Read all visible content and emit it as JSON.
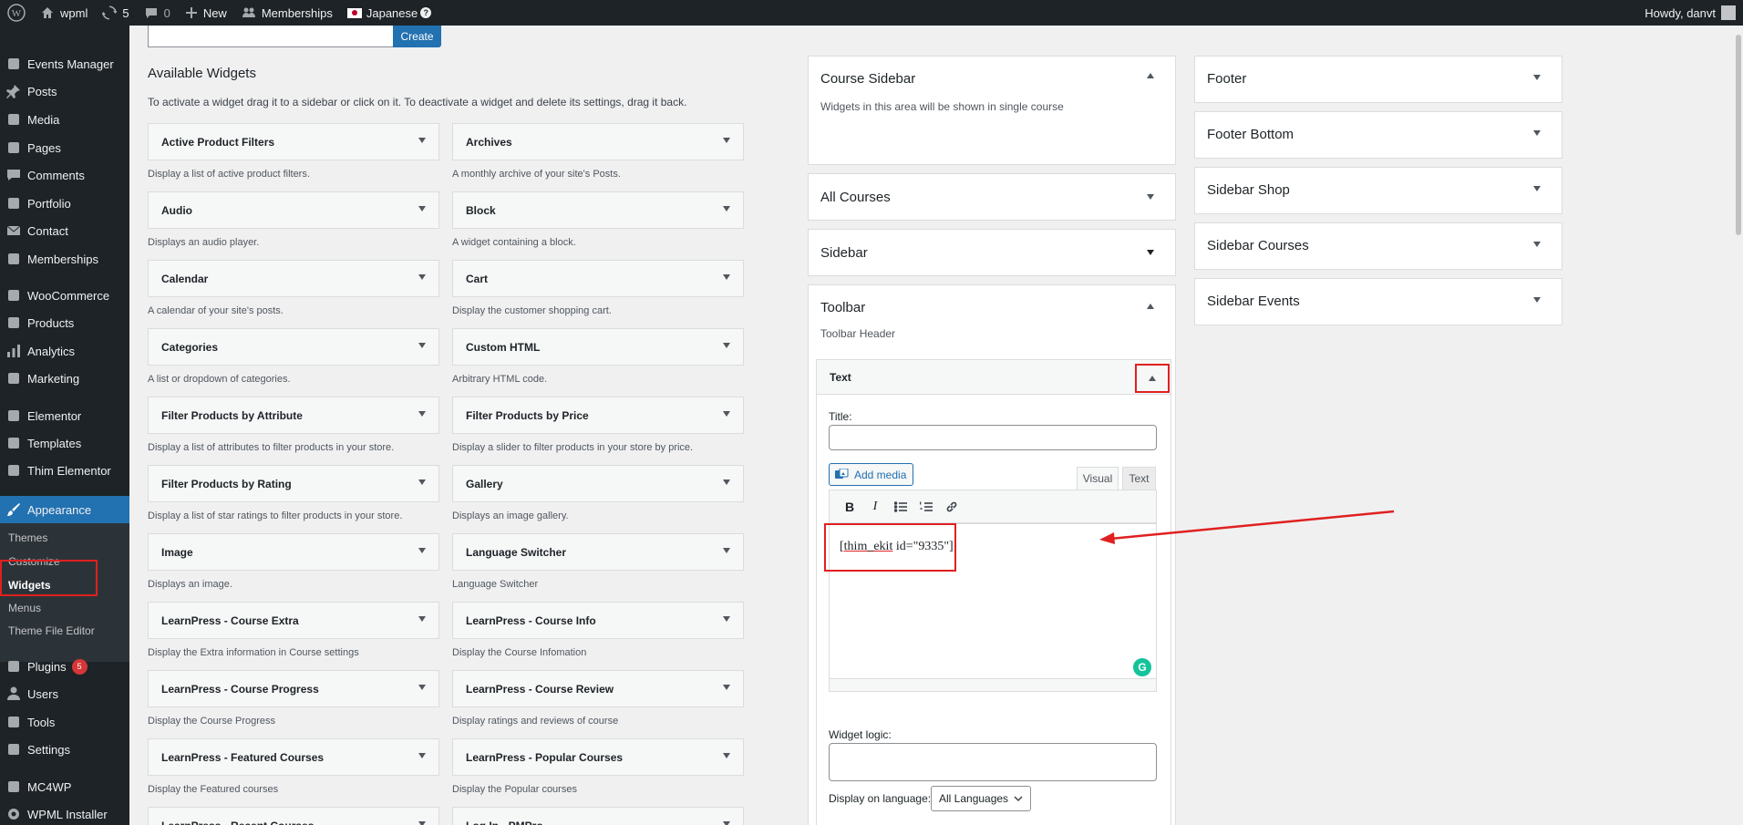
{
  "admin_bar": {
    "site_name": "wpml",
    "updates_count": "5",
    "comments_count": "0",
    "new_label": "New",
    "memberships_label": "Memberships",
    "language_label": "Japanese",
    "language_help": "?",
    "howdy": "Howdy, danvt"
  },
  "menu": {
    "items": [
      {
        "label": "Events Manager",
        "icon": "calendar-icon"
      },
      {
        "label": "Posts",
        "icon": "pin-icon"
      },
      {
        "label": "Media",
        "icon": "media-icon"
      },
      {
        "label": "Pages",
        "icon": "page-icon"
      },
      {
        "label": "Comments",
        "icon": "comment-icon"
      },
      {
        "label": "Portfolio",
        "icon": "portfolio-icon"
      },
      {
        "label": "Contact",
        "icon": "mail-icon"
      },
      {
        "label": "Memberships",
        "icon": "groups-icon"
      },
      {
        "label": "WooCommerce",
        "icon": "woo-icon"
      },
      {
        "label": "Products",
        "icon": "archive-icon"
      },
      {
        "label": "Analytics",
        "icon": "chart-icon"
      },
      {
        "label": "Marketing",
        "icon": "megaphone-icon"
      },
      {
        "label": "Elementor",
        "icon": "elementor-icon"
      },
      {
        "label": "Templates",
        "icon": "folder-icon"
      },
      {
        "label": "Thim Elementor",
        "icon": "thim-icon"
      },
      {
        "label": "Appearance",
        "icon": "brush-icon"
      },
      {
        "label": "Plugins",
        "icon": "plugin-icon",
        "badge": "5"
      },
      {
        "label": "Users",
        "icon": "users-icon"
      },
      {
        "label": "Tools",
        "icon": "wrench-icon"
      },
      {
        "label": "Settings",
        "icon": "settings-icon"
      },
      {
        "label": "MC4WP",
        "icon": "mc4wp-icon"
      },
      {
        "label": "WPML Installer",
        "icon": "gear-icon"
      }
    ],
    "submenu": [
      "Themes",
      "Customize",
      "Widgets",
      "Menus",
      "Theme File Editor"
    ]
  },
  "create_button": "Create",
  "available": {
    "title": "Available Widgets",
    "description": "To activate a widget drag it to a sidebar or click on it. To deactivate a widget and delete its settings, drag it back.",
    "widgets": [
      {
        "name": "Active Product Filters",
        "desc": "Display a list of active product filters."
      },
      {
        "name": "Archives",
        "desc": "A monthly archive of your site's Posts."
      },
      {
        "name": "Audio",
        "desc": "Displays an audio player."
      },
      {
        "name": "Block",
        "desc": "A widget containing a block."
      },
      {
        "name": "Calendar",
        "desc": "A calendar of your site's posts."
      },
      {
        "name": "Cart",
        "desc": "Display the customer shopping cart."
      },
      {
        "name": "Categories",
        "desc": "A list or dropdown of categories."
      },
      {
        "name": "Custom HTML",
        "desc": "Arbitrary HTML code."
      },
      {
        "name": "Filter Products by Attribute",
        "desc": "Display a list of attributes to filter products in your store."
      },
      {
        "name": "Filter Products by Price",
        "desc": "Display a slider to filter products in your store by price."
      },
      {
        "name": "Filter Products by Rating",
        "desc": "Display a list of star ratings to filter products in your store."
      },
      {
        "name": "Gallery",
        "desc": "Displays an image gallery."
      },
      {
        "name": "Image",
        "desc": "Displays an image."
      },
      {
        "name": "Language Switcher",
        "desc": "Language Switcher"
      },
      {
        "name": "LearnPress - Course Extra",
        "desc": "Display the Extra information in Course settings"
      },
      {
        "name": "LearnPress - Course Info",
        "desc": "Display the Course Infomation"
      },
      {
        "name": "LearnPress - Course Progress",
        "desc": "Display the Course Progress"
      },
      {
        "name": "LearnPress - Course Review",
        "desc": "Display ratings and reviews of course"
      },
      {
        "name": "LearnPress - Featured Courses",
        "desc": "Display the Featured courses"
      },
      {
        "name": "LearnPress - Popular Courses",
        "desc": "Display the Popular courses"
      },
      {
        "name": "LearnPress - Recent Courses",
        "desc": ""
      },
      {
        "name": "Log In - PMPro",
        "desc": ""
      }
    ]
  },
  "areas_col1": {
    "course_sidebar": {
      "title": "Course Sidebar",
      "desc": "Widgets in this area will be shown in single course"
    },
    "all_courses": {
      "title": "All Courses"
    },
    "sidebar": {
      "title": "Sidebar"
    },
    "toolbar": {
      "title": "Toolbar",
      "desc": "Toolbar Header"
    }
  },
  "text_widget": {
    "header": "Text",
    "title_label": "Title:",
    "title_value": "",
    "add_media": "Add media",
    "tab_visual": "Visual",
    "tab_text": "Text",
    "content_underlined": "thim_ekit",
    "content_prefix": "[",
    "content_suffix": " id=\"9335\"]",
    "widget_logic_label": "Widget logic:",
    "display_language_label": "Display on language:",
    "display_language_value": "All Languages"
  },
  "areas_col2": [
    "Footer",
    "Footer Bottom",
    "Sidebar Shop",
    "Sidebar Courses",
    "Sidebar Events"
  ],
  "colors": {
    "accent": "#2271b1",
    "highlight": "#e02020",
    "admin_dark": "#1d2327"
  }
}
